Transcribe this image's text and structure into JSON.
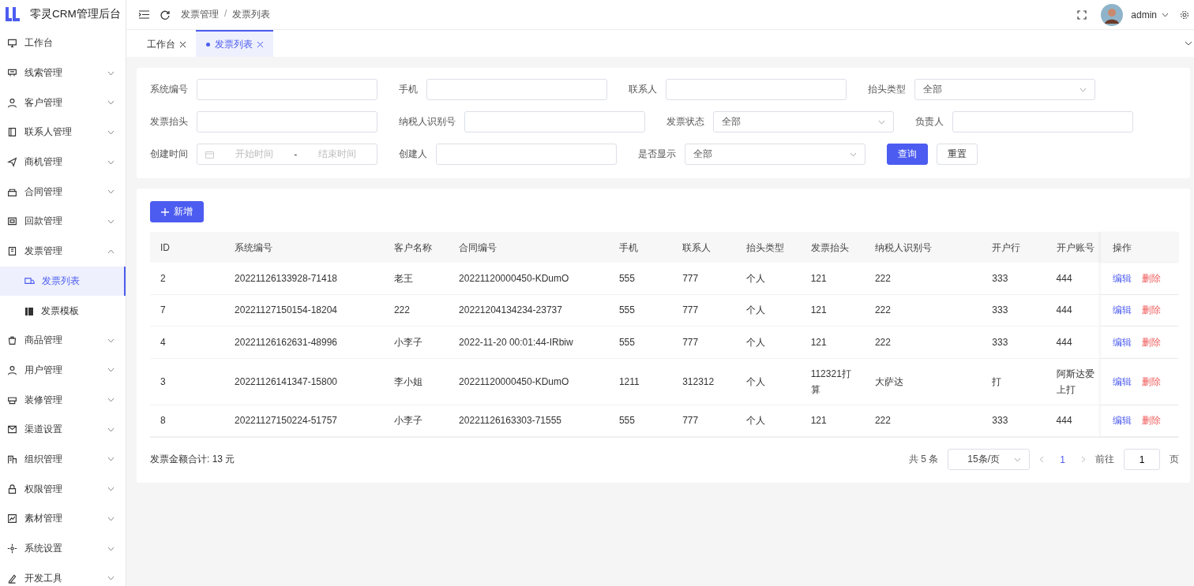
{
  "app": {
    "title": "零灵CRM管理后台"
  },
  "sidebar": {
    "items": [
      {
        "label": "工作台",
        "expandable": false,
        "expanded": false,
        "selected": false
      },
      {
        "label": "线索管理",
        "expandable": true,
        "expanded": false,
        "selected": false
      },
      {
        "label": "客户管理",
        "expandable": true,
        "expanded": false,
        "selected": false
      },
      {
        "label": "联系人管理",
        "expandable": true,
        "expanded": false,
        "selected": false
      },
      {
        "label": "商机管理",
        "expandable": true,
        "expanded": false,
        "selected": false
      },
      {
        "label": "合同管理",
        "expandable": true,
        "expanded": false,
        "selected": false
      },
      {
        "label": "回款管理",
        "expandable": true,
        "expanded": false,
        "selected": false
      },
      {
        "label": "发票管理",
        "expandable": true,
        "expanded": true,
        "selected": false,
        "children": [
          {
            "label": "发票列表",
            "selected": true
          },
          {
            "label": "发票模板",
            "selected": false
          }
        ]
      },
      {
        "label": "商品管理",
        "expandable": true,
        "expanded": false,
        "selected": false
      },
      {
        "label": "用户管理",
        "expandable": true,
        "expanded": false,
        "selected": false
      },
      {
        "label": "装修管理",
        "expandable": true,
        "expanded": false,
        "selected": false
      },
      {
        "label": "渠道设置",
        "expandable": true,
        "expanded": false,
        "selected": false
      },
      {
        "label": "组织管理",
        "expandable": true,
        "expanded": false,
        "selected": false
      },
      {
        "label": "权限管理",
        "expandable": true,
        "expanded": false,
        "selected": false
      },
      {
        "label": "素材管理",
        "expandable": true,
        "expanded": false,
        "selected": false
      },
      {
        "label": "系统设置",
        "expandable": true,
        "expanded": false,
        "selected": false
      },
      {
        "label": "开发工具",
        "expandable": true,
        "expanded": false,
        "selected": false
      }
    ]
  },
  "header": {
    "breadcrumb": [
      "发票管理",
      "发票列表"
    ],
    "breadcrumb_separator": "/",
    "user": "admin"
  },
  "tabs": [
    {
      "label": "工作台",
      "selected": false
    },
    {
      "label": "发票列表",
      "selected": true
    }
  ],
  "filters": [
    [
      {
        "kind": "input",
        "label": "系统编号"
      },
      {
        "kind": "input",
        "label": "手机"
      },
      {
        "kind": "input",
        "label": "联系人"
      },
      {
        "kind": "select",
        "label": "抬头类型",
        "value": "全部"
      }
    ],
    [
      {
        "kind": "input",
        "label": "发票抬头"
      },
      {
        "kind": "input",
        "label": "纳税人识别号"
      },
      {
        "kind": "select",
        "label": "发票状态",
        "value": "全部"
      },
      {
        "kind": "input",
        "label": "负责人"
      }
    ],
    [
      {
        "kind": "daterange",
        "label": "创建时间",
        "start_placeholder": "开始时间",
        "separator": "-",
        "end_placeholder": "结束时间"
      },
      {
        "kind": "input",
        "label": "创建人"
      },
      {
        "kind": "select",
        "label": "是否显示",
        "value": "全部"
      }
    ]
  ],
  "filter_buttons": [
    {
      "label": "查询",
      "primary": true
    },
    {
      "label": "重置",
      "primary": false
    }
  ],
  "add_button": "新增",
  "table": {
    "columns": [
      "ID",
      "系统编号",
      "客户名称",
      "合同编号",
      "手机",
      "联系人",
      "抬头类型",
      "发票抬头",
      "纳税人识别号",
      "开户行",
      "开户账号",
      "操作"
    ],
    "rows": [
      {
        "cells": [
          "2",
          "20221126133928-71418",
          "老王",
          "20221120000450-KDumO",
          "555",
          "777",
          "个人",
          "121",
          "222",
          "333",
          "444"
        ],
        "actions": [
          "编辑",
          "删除"
        ]
      },
      {
        "cells": [
          "7",
          "20221127150154-18204",
          "222",
          "20221204134234-23737",
          "555",
          "777",
          "个人",
          "121",
          "222",
          "333",
          "444"
        ],
        "actions": [
          "编辑",
          "删除"
        ]
      },
      {
        "cells": [
          "4",
          "20221126162631-48996",
          "小李子",
          "2022-11-20 00:01:44-IRbiw",
          "555",
          "777",
          "个人",
          "121",
          "222",
          "333",
          "444"
        ],
        "actions": [
          "编辑",
          "删除"
        ]
      },
      {
        "cells": [
          "3",
          "20221126141347-15800",
          "李小姐",
          "20221120000450-KDumO",
          "1211",
          "312312",
          "个人",
          "112321打算",
          "大萨达",
          "打",
          "阿斯达爱上打"
        ],
        "actions": [
          "编辑",
          "删除"
        ]
      },
      {
        "cells": [
          "8",
          "20221127150224-51757",
          "小李子",
          "20221126163303-71555",
          "555",
          "777",
          "个人",
          "121",
          "222",
          "333",
          "444"
        ],
        "actions": [
          "编辑",
          "删除"
        ]
      }
    ]
  },
  "summary": "发票金额合计: 13 元",
  "pagination": {
    "total": "共 5 条",
    "page_size": "15条/页",
    "pages": [
      {
        "label": "1",
        "selected": true
      }
    ],
    "goto_label": "前往",
    "goto_value": "1",
    "goto_suffix": "页"
  }
}
